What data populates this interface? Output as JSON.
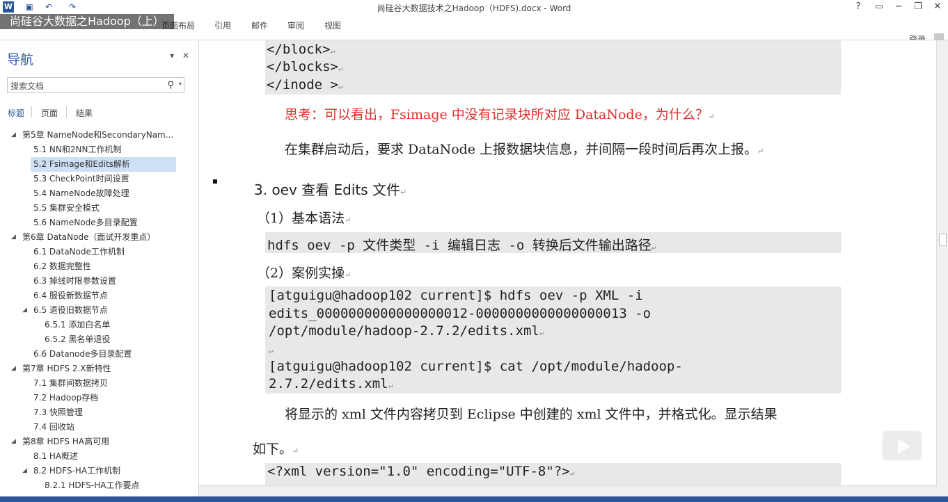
{
  "window": {
    "title": "尚硅谷大数据技术之Hadoop（HDFS).docx - Word",
    "overlay_title": "尚硅谷大数据之Hadoop（上）",
    "help": "?",
    "minimize": "−",
    "restore": "❐",
    "close": "✕",
    "signin": "登录"
  },
  "ribbon": {
    "tabs": [
      "页面布局",
      "引用",
      "邮件",
      "审阅",
      "视图"
    ]
  },
  "nav": {
    "title": "导航",
    "search_placeholder": "搜索文档",
    "tabs": [
      "标题",
      "页面",
      "结果"
    ],
    "items": [
      "第5章 NameNode和SecondaryNam...",
      "5.1 NN和2NN工作机制",
      "5.2 Fsimage和Edits解析",
      "5.3 CheckPoint时间设置",
      "5.4 NameNode故障处理",
      "5.5 集群安全模式",
      "5.6 NameNode多目录配置",
      "第6章 DataNode（面试开发重点）",
      "6.1 DataNode工作机制",
      "6.2 数据完整性",
      "6.3 掉线时限参数设置",
      "6.4 服役新数据节点",
      "6.5 退役旧数据节点",
      "6.5.1 添加白名单",
      "6.5.2 黑名单退役",
      "6.6 Datanode多目录配置",
      "第7章 HDFS 2.X新特性",
      "7.1 集群间数据拷贝",
      "7.2 Hadoop存档",
      "7.3 快照管理",
      "7.4 回收站",
      "第8章 HDFS HA高可用",
      "8.1 HA概述",
      "8.2 HDFS-HA工作机制",
      "8.2.1 HDFS-HA工作要点"
    ]
  },
  "doc": {
    "code1": [
      "    </block>",
      "  </blocks>",
      "</inode >"
    ],
    "think": "思考：可以看出，Fsimage 中没有记录块所对应 DataNode，为什么？",
    "para1": "在集群启动后，要求 DataNode 上报数据块信息，并间隔一段时间后再次上报。",
    "heading": "3. oev 查看 Edits 文件",
    "sub1": "（1）基本语法",
    "syntax": "hdfs oev -p 文件类型 -i 编辑日志 -o 转换后文件输出路径",
    "sub2": "（2）案例实操",
    "case1": [
      "[atguigu@hadoop102    current]$    hdfs    oev    -p    XML    -i",
      "edits_0000000000000000012-0000000000000000013              -o",
      "/opt/module/hadoop-2.7.2/edits.xml"
    ],
    "case2": [
      "[atguigu@hadoop102    current]$    cat    /opt/module/hadoop-",
      "2.7.2/edits.xml"
    ],
    "para2a": "将显示的 xml 文件内容拷贝到 Eclipse 中创建的 xml 文件中，并格式化。显示结果",
    "para2b": "如下。",
    "xml": "<?xml version=\"1.0\" encoding=\"UTF-8\"?>"
  }
}
